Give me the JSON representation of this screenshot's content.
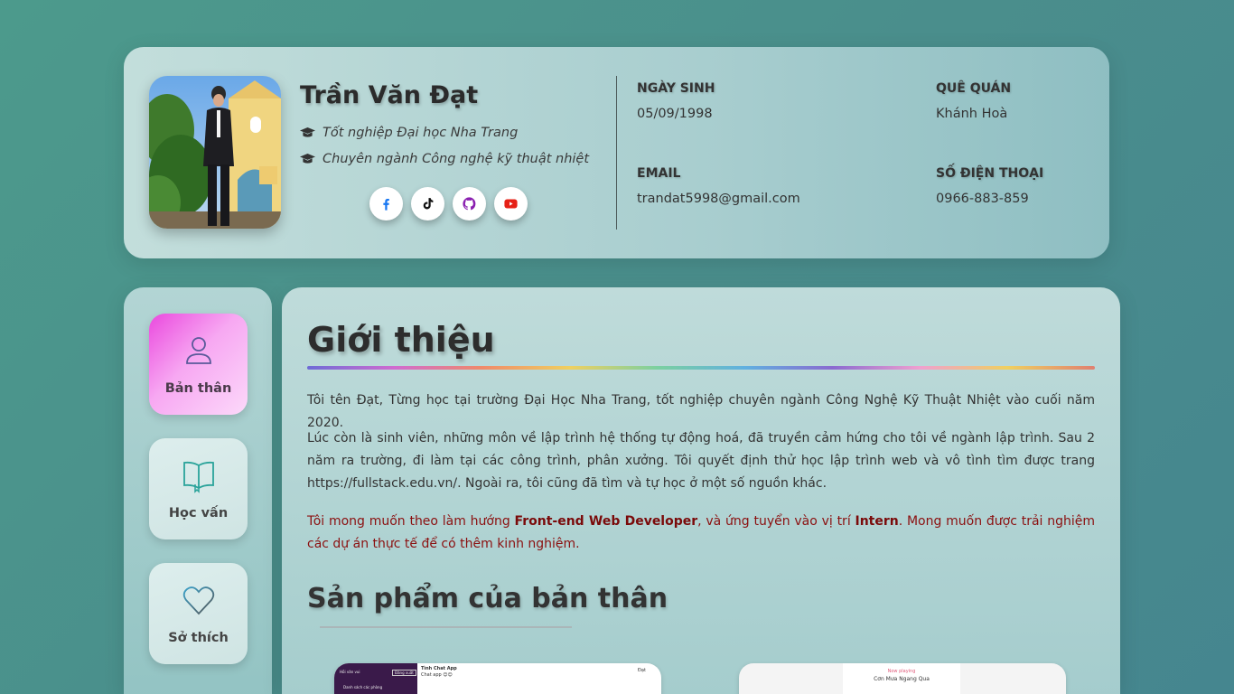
{
  "profile": {
    "name": "Trần Văn Đạt",
    "education": "Tốt nghiệp Đại học Nha Trang",
    "major": "Chuyên ngành Công nghệ kỹ thuật nhiệt",
    "socials": [
      {
        "name": "facebook-icon",
        "color": "#1877f2"
      },
      {
        "name": "tiktok-icon",
        "color": "#111111"
      },
      {
        "name": "github-icon",
        "color": "#8a1fb0"
      },
      {
        "name": "youtube-icon",
        "color": "#e62117"
      }
    ]
  },
  "info": {
    "birthday_label": "NGÀY SINH",
    "birthday_value": "05/09/1998",
    "hometown_label": "QUÊ QUÁN",
    "hometown_value": "Khánh Hoà",
    "email_label": "EMAIL",
    "email_value": "trandat5998@gmail.com",
    "phone_label": "SỐ ĐIỆN THOẠI",
    "phone_value": "0966-883-859"
  },
  "sidebar": {
    "items": [
      {
        "label": "Bản thân",
        "icon": "user-icon",
        "active": true
      },
      {
        "label": "Học vấn",
        "icon": "book-icon",
        "active": false
      },
      {
        "label": "Sở thích",
        "icon": "heart-icon",
        "active": false
      }
    ]
  },
  "main": {
    "title": "Giới thiệu",
    "p1": "Tôi tên Đạt, Từng học tại trường Đại Học Nha Trang, tốt nghiệp chuyên ngành Công Nghệ Kỹ Thuật Nhiệt vào cuối năm 2020.",
    "p2": "Lúc còn là sinh viên, những môn về lập trình hệ thống tự động hoá, đã truyền cảm hứng cho tôi về ngành lập trình. Sau 2 năm ra trường, đi làm tại các công trình, phân xưởng. Tôi quyết định thử học lập trình web và vô tình tìm được trang https://fullstack.edu.vn/. Ngoài ra, tôi cũng đã tìm và tự học ở một số nguồn khác.",
    "p3_a": "Tôi mong muốn theo làm hướng ",
    "p3_b": "Front-end Web Developer",
    "p3_c": ", và ứng tuyển vào vị trí ",
    "p3_d": "Intern",
    "p3_e": ". Mong muốn được trải nghiệm các dự án thực tế để có thêm kinh nghiệm.",
    "products_title": "Sản phẩm của bản thân",
    "product_left": {
      "side_title": "Hồi văn vui",
      "side_btn": "Đăng xuất",
      "side_item": "Danh sách các phòng",
      "chat_title": "Tình Chat App",
      "chat_sub": "Chat app 😊😊",
      "user": "Đạt"
    },
    "product_right": {
      "label": "Now playing",
      "song": "Cơn Mưa Ngang Qua"
    }
  },
  "colors": {
    "accent_pink": "#ea49de",
    "heading_red": "#8b1010"
  }
}
